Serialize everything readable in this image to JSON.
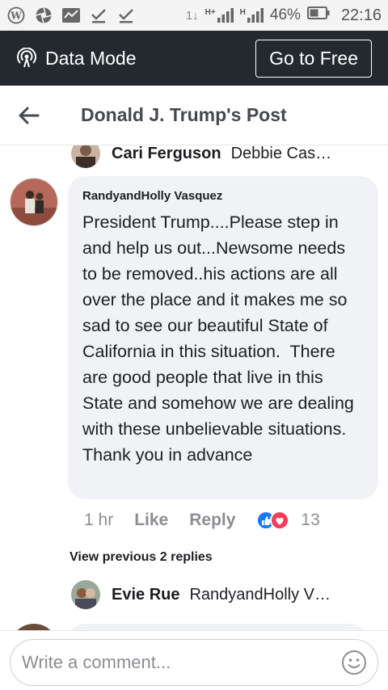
{
  "status_bar": {
    "battery": "46%",
    "time": "22:16",
    "signal_1": "H+",
    "signal_2": "H",
    "data_arrows": "1↓"
  },
  "data_mode": {
    "label": "Data Mode",
    "go_free": "Go to Free"
  },
  "header": {
    "title": "Donald J. Trump's Post"
  },
  "top_reply": {
    "name": "Cari Ferguson",
    "preview": "Debbie Cas…"
  },
  "comment": {
    "author": "RandyandHolly Vasquez",
    "text": "President Trump....Please step in and help us out...Newsome needs to be removed..his actions are all over the place and it makes me so sad to see our beautiful State of California in this situation.  There are good people that live in this State and somehow we are dealing with these unbelievable situations. Thank you in advance",
    "time": "1 hr",
    "like": "Like",
    "reply": "Reply",
    "reaction_count": "13"
  },
  "view_previous": "View previous 2 replies",
  "bottom_reply": {
    "name": "Evie Rue",
    "preview": "RandyandHolly V…"
  },
  "composer": {
    "placeholder": "Write a comment..."
  },
  "colors": {
    "like_blue": "#1877f2",
    "love_red": "#f33e58",
    "dark_bar": "#24292f",
    "bubble": "#f0f2f5"
  }
}
